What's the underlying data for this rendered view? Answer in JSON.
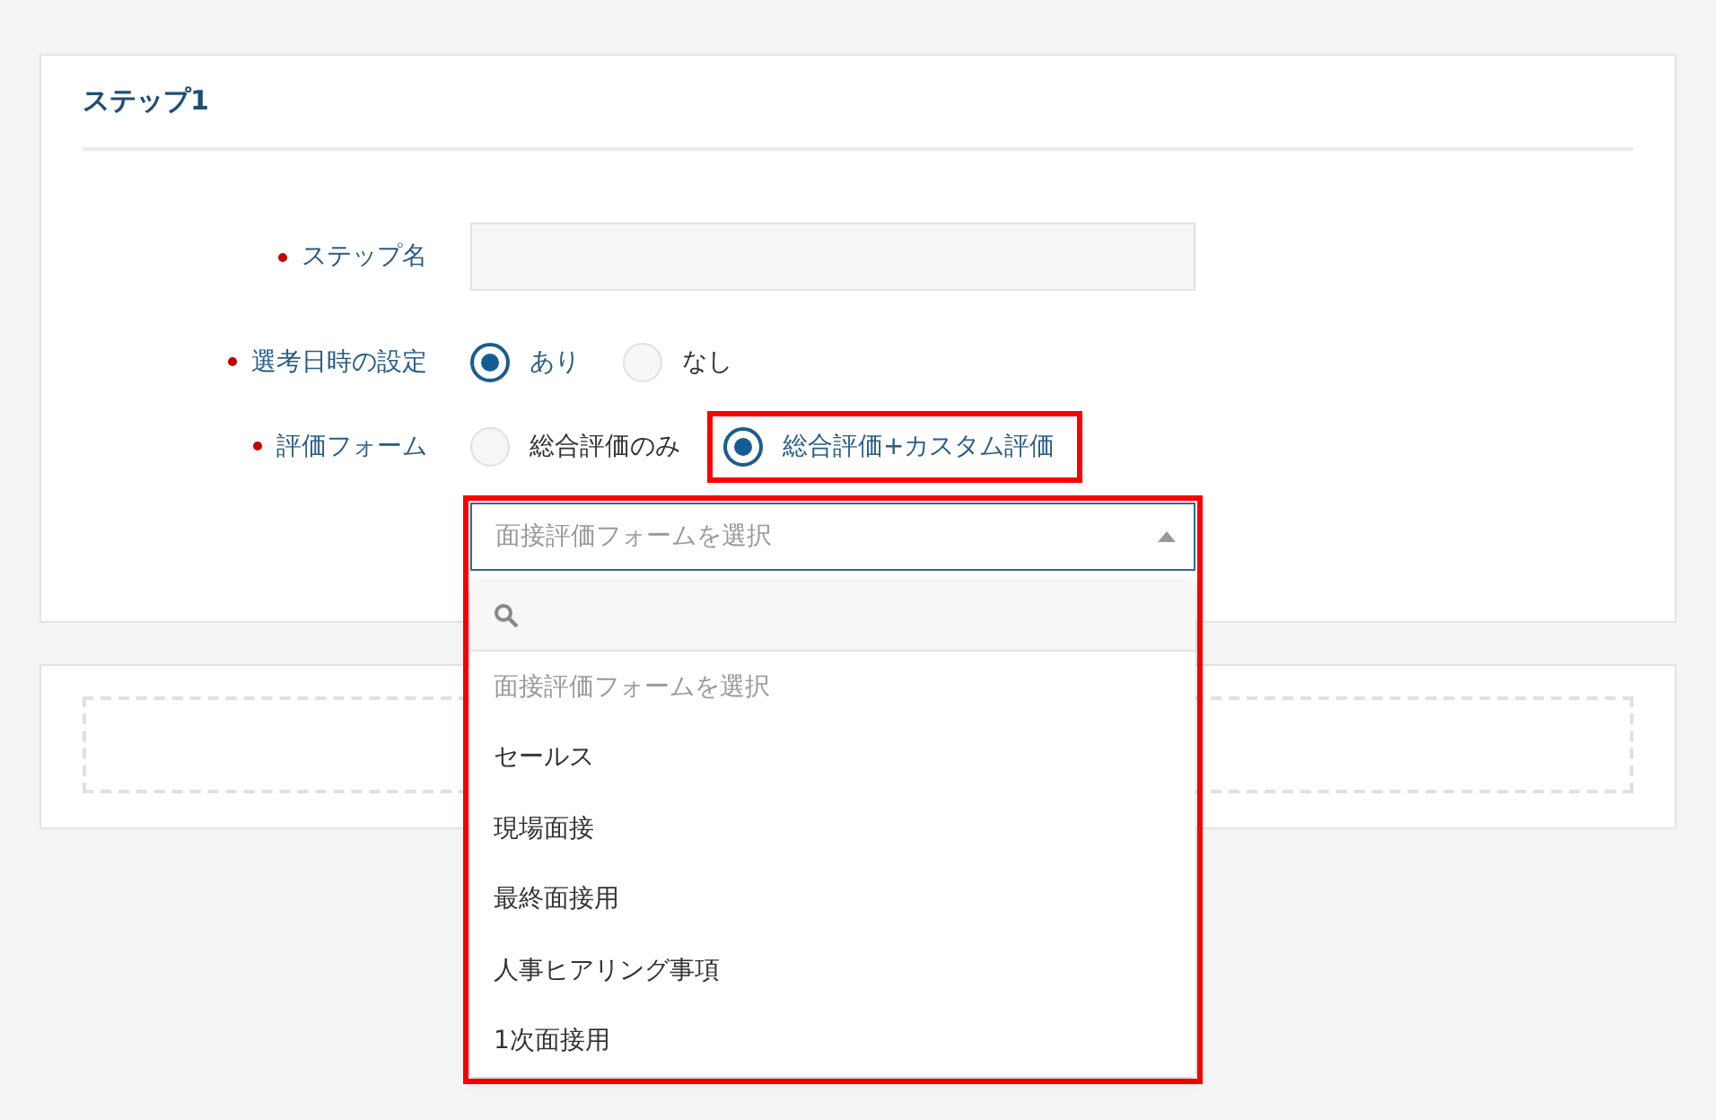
{
  "step": {
    "title": "ステップ1",
    "fields": [
      {
        "kind": "text",
        "label": "ステップ名",
        "required": true
      },
      {
        "kind": "radio",
        "label": "選考日時の設定",
        "required": true,
        "options": [
          {
            "label": "あり",
            "selected": true
          },
          {
            "label": "なし",
            "selected": false
          }
        ]
      },
      {
        "kind": "radio",
        "label": "評価フォーム",
        "required": true,
        "options": [
          {
            "label": "総合評価のみ",
            "selected": false
          },
          {
            "label": "総合評価+カスタム評価",
            "selected": true,
            "highlighted": true
          }
        ]
      }
    ],
    "select": {
      "placeholder": "面接評価フォームを選択",
      "expanded": true,
      "highlighted": true,
      "options": [
        {
          "label": "面接評価フォームを選択",
          "kind": "placeholder"
        },
        {
          "label": "セールス",
          "kind": "option"
        },
        {
          "label": "現場面接",
          "kind": "option"
        },
        {
          "label": "最終面接用",
          "kind": "option"
        },
        {
          "label": "人事ヒアリング事項",
          "kind": "option"
        },
        {
          "label": "1次面接用",
          "kind": "option"
        }
      ]
    }
  }
}
